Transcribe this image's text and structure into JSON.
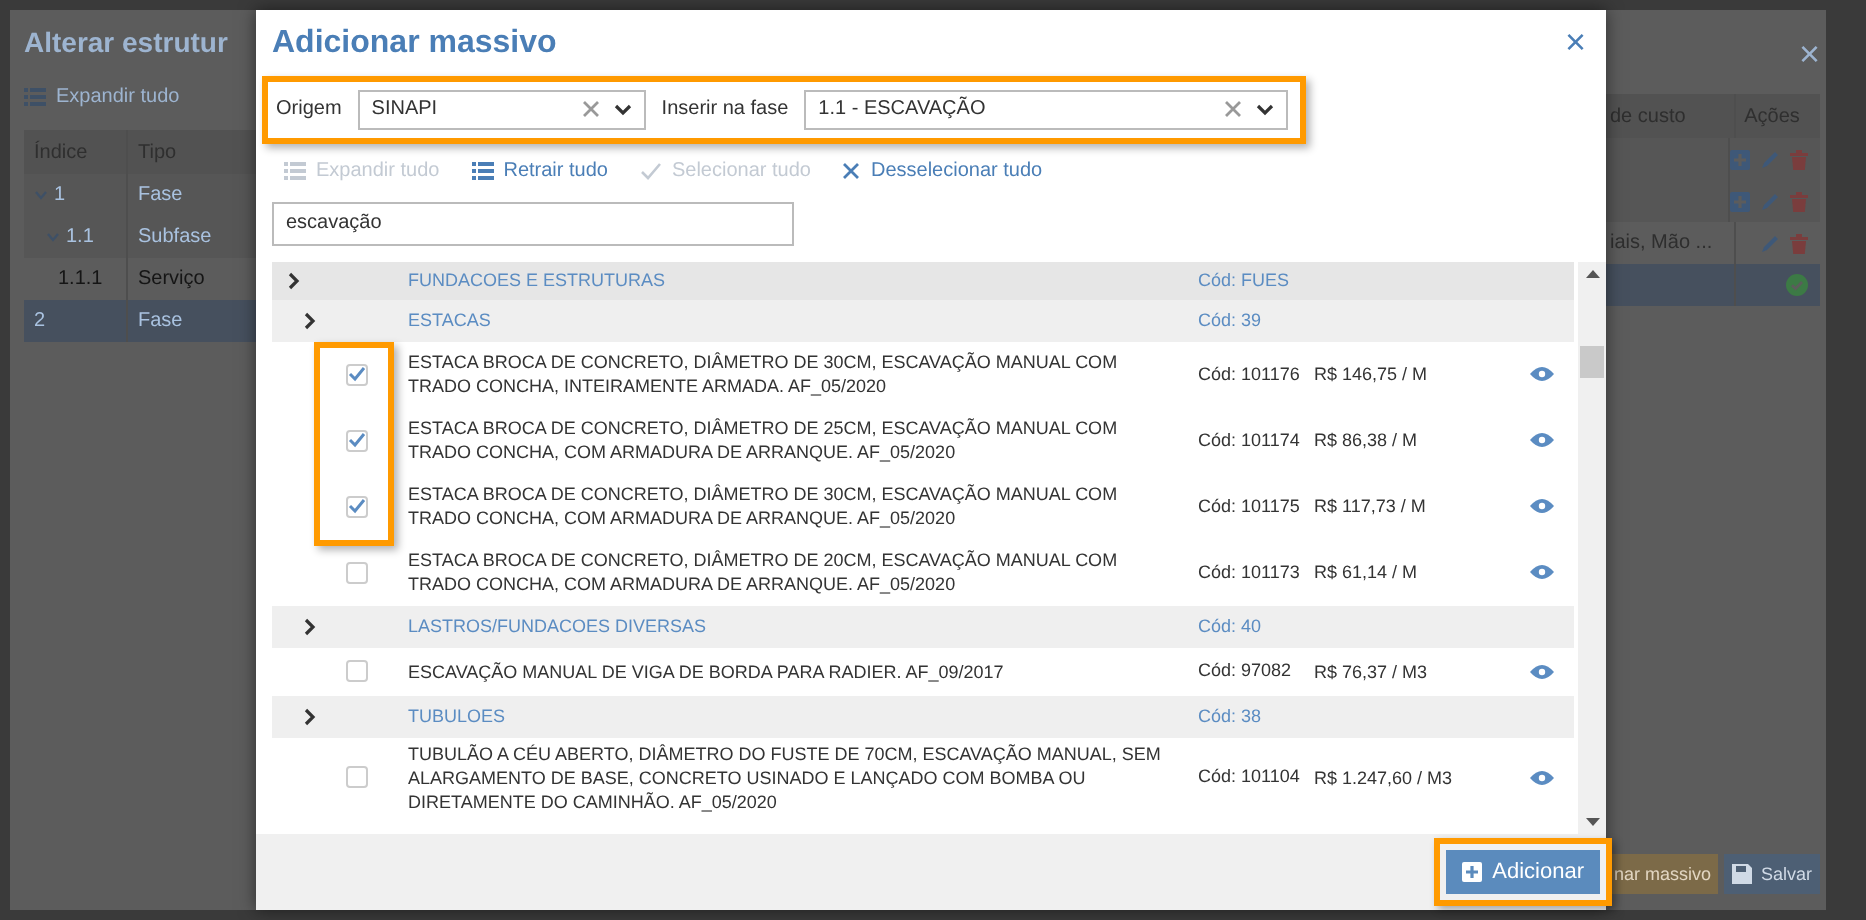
{
  "background": {
    "title": "Alterar estrutur",
    "toolbar_label": "Expandir tudo",
    "close_button": "×",
    "columns_left": [
      "Índice",
      "Tipo"
    ],
    "columns_right": [
      "de custo",
      "Ações"
    ],
    "rows": [
      {
        "index": "1",
        "type": "Fase",
        "kind": "group",
        "selected": false,
        "children": [
          {
            "index": "1.1",
            "type": "Subfase",
            "kind": "group",
            "selected": false,
            "children": [
              {
                "index": "1.1.1",
                "type": "Serviço",
                "kind": "item",
                "selected": false,
                "cost": "iais, Mão ..."
              }
            ]
          }
        ]
      },
      {
        "index": "2",
        "type": "Fase",
        "kind": "group",
        "selected": true
      }
    ],
    "buttons": [
      {
        "label": "nar massivo",
        "kind": "warning"
      },
      {
        "label": "Salvar",
        "kind": "primary"
      }
    ]
  },
  "modal": {
    "title": "Adicionar massivo",
    "filters": [
      {
        "label": "Origem",
        "value": "SINAPI"
      },
      {
        "label": "Inserir na fase",
        "value": "1.1 - ESCAVAÇÃO"
      }
    ],
    "toolbar": [
      {
        "label": "Expandir tudo",
        "disabled": true
      },
      {
        "label": "Retrair tudo",
        "disabled": false
      },
      {
        "label": "Selecionar tudo",
        "disabled": true
      },
      {
        "label": "Desselecionar tudo",
        "disabled": false
      }
    ],
    "search": {
      "value": "escavação"
    },
    "tree": [
      {
        "label": "FUNDACOES E ESTRUTURAS",
        "code": "Cód: FUES",
        "children": [
          {
            "label": "ESTACAS",
            "code": "Cód: 39",
            "children": [
              {
                "description": "ESTACA BROCA DE CONCRETO, DIÂMETRO DE 30CM, ESCAVAÇÃO MANUAL COM TRADO CONCHA, INTEIRAMENTE ARMADA. AF_05/2020",
                "code": "Cód: 101176",
                "price": "R$ 146,75 / M",
                "checked": true
              },
              {
                "description": "ESTACA BROCA DE CONCRETO, DIÂMETRO DE 25CM, ESCAVAÇÃO MANUAL COM TRADO CONCHA, COM ARMADURA DE ARRANQUE. AF_05/2020",
                "code": "Cód: 101174",
                "price": "R$ 86,38 / M",
                "checked": true
              },
              {
                "description": "ESTACA BROCA DE CONCRETO, DIÂMETRO DE 30CM, ESCAVAÇÃO MANUAL COM TRADO CONCHA, COM ARMADURA DE ARRANQUE. AF_05/2020",
                "code": "Cód: 101175",
                "price": "R$ 117,73 / M",
                "checked": true
              },
              {
                "description": "ESTACA BROCA DE CONCRETO, DIÂMETRO DE 20CM, ESCAVAÇÃO MANUAL COM TRADO CONCHA, COM ARMADURA DE ARRANQUE. AF_05/2020",
                "code": "Cód: 101173",
                "price": "R$ 61,14 / M",
                "checked": false
              }
            ]
          },
          {
            "label": "LASTROS/FUNDACOES DIVERSAS",
            "code": "Cód: 40",
            "children": [
              {
                "description": "ESCAVAÇÃO MANUAL DE VIGA DE BORDA PARA RADIER. AF_09/2017",
                "code": "Cód: 97082",
                "price": "R$ 76,37 / M3",
                "checked": false
              }
            ]
          },
          {
            "label": "TUBULOES",
            "code": "Cód: 38",
            "children": [
              {
                "description": "TUBULÃO A CÉU ABERTO, DIÂMETRO DO FUSTE DE 70CM, ESCAVAÇÃO MANUAL, SEM ALARGAMENTO DE BASE, CONCRETO USINADO E LANÇADO COM BOMBA OU DIRETAMENTE DO CAMINHÃO. AF_05/2020",
                "code": "Cód: 101104",
                "price": "R$ 1.247,60 / M3",
                "checked": false
              }
            ]
          }
        ]
      }
    ],
    "close_button": "×",
    "add_button": "Adicionar"
  }
}
